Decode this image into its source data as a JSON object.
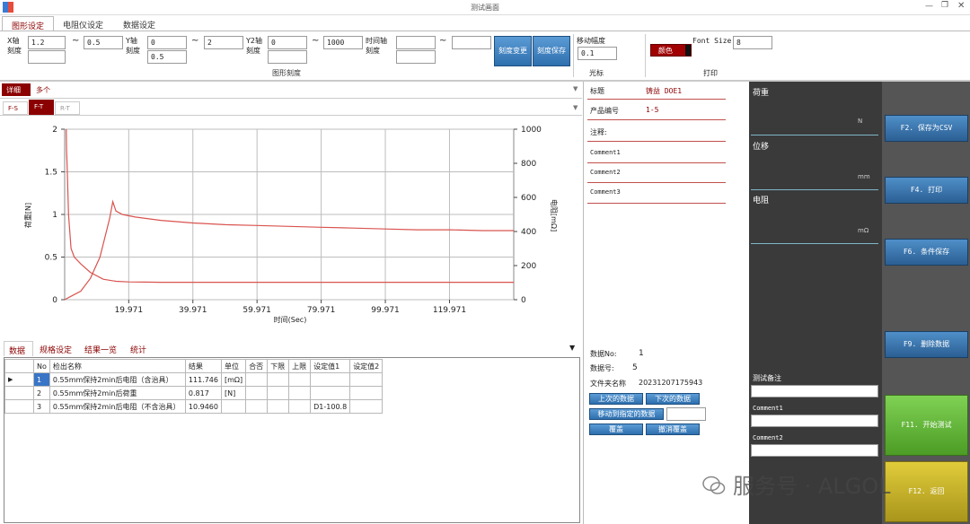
{
  "window": {
    "title": "测试画面"
  },
  "menu_tabs": [
    "图形设定",
    "电阻仪设定",
    "数据设定"
  ],
  "axis_settings": {
    "x_label": "X轴\n刻度",
    "x_min": "1.2",
    "x_max": "0.5",
    "x_extra": "",
    "y_label": "Y轴\n刻度",
    "y_min": "0",
    "y_max": "2",
    "y_extra": "0.5",
    "y2_label": "Y2轴\n刻度",
    "y2_min": "0",
    "y2_max": "1000",
    "y2_extra": "",
    "t_label": "时间轴\n刻度",
    "t_min": "",
    "t_max": "",
    "t_extra": "",
    "tilde": "~",
    "group_label": "图形刻度",
    "btn_change": "刻度变更",
    "btn_save": "刻度保存"
  },
  "cursor": {
    "label": "移动幅度",
    "value": "0.1",
    "group_label": "光标"
  },
  "print_group": {
    "color_label": "颜色",
    "font_label": "Font Size",
    "font_value": "8",
    "group_label": "打印"
  },
  "detail": {
    "btn": "详细",
    "mode": "多个",
    "subtabs": [
      "F-S",
      "F-T",
      "R-T"
    ]
  },
  "chart_data": {
    "type": "line",
    "xlabel": "时间(Sec)",
    "ylabel": "荷重[N]",
    "y2label": "电阻[mΩ]",
    "xlim": [
      0,
      140
    ],
    "ylim": [
      0,
      2
    ],
    "y2lim": [
      0,
      1000
    ],
    "x_ticks": [
      "19.971",
      "39.971",
      "59.971",
      "79.971",
      "99.971",
      "119.971"
    ],
    "x_tick_values": [
      19.971,
      39.971,
      59.971,
      79.971,
      99.971,
      119.971
    ],
    "y_ticks": [
      "0",
      "0.5",
      "1",
      "1.5",
      "2"
    ],
    "y2_ticks": [
      "0",
      "200",
      "400",
      "600",
      "800",
      "1000"
    ],
    "grid": true,
    "series": [
      {
        "axis": "y2",
        "color": "#d9534f",
        "x": [
          0.5,
          0.6,
          0.8,
          1.2,
          2,
          3,
          5,
          8,
          12,
          16,
          20,
          25,
          30,
          40,
          50,
          60,
          70,
          80,
          90,
          100,
          110,
          120,
          130,
          140
        ],
        "y": [
          1000,
          880,
          760,
          500,
          300,
          250,
          210,
          160,
          120,
          108,
          104,
          103,
          102,
          102,
          102,
          102,
          102,
          102,
          102,
          102,
          102,
          102,
          102,
          102
        ]
      },
      {
        "axis": "y",
        "color": "#d9534f",
        "x": [
          0,
          2,
          5,
          8,
          11,
          14,
          15,
          16,
          18,
          22,
          30,
          40,
          50,
          60,
          70,
          80,
          90,
          100,
          110,
          120,
          130,
          140
        ],
        "y": [
          0,
          0.04,
          0.1,
          0.25,
          0.5,
          0.95,
          1.15,
          1.04,
          1.0,
          0.97,
          0.93,
          0.9,
          0.88,
          0.87,
          0.86,
          0.85,
          0.84,
          0.83,
          0.82,
          0.82,
          0.81,
          0.81
        ]
      }
    ]
  },
  "info_panel": {
    "title_label": "标题",
    "title_value": "铸益 DOE1",
    "product_label": "产品编号",
    "product_value": "1-5",
    "note_label": "注释:",
    "comments": [
      "Comment1",
      "Comment2",
      "Comment3"
    ]
  },
  "data_tabs": [
    "数据",
    "规格设定",
    "结果一览",
    "统计"
  ],
  "table": {
    "headers": [
      "No",
      "检出名称",
      "结果",
      "单位",
      "合否",
      "下限",
      "上限",
      "设定值1",
      "设定值2"
    ],
    "rows": [
      [
        "1",
        "0.55mm保持2min后电阻（含治具）",
        "111.746",
        "[mΩ]",
        "",
        "",
        "",
        "",
        ""
      ],
      [
        "2",
        "0.55mm保持2min后荷重",
        "0.817",
        "[N]",
        "",
        "",
        "",
        "",
        ""
      ],
      [
        "3",
        "0.55mm保持2min后电阻（不含治具）",
        "10.9460",
        "",
        "",
        "",
        "",
        "D1-100.8",
        ""
      ]
    ]
  },
  "data_info": {
    "datano_label": "数据No:",
    "datano_value": "1",
    "count_label": "数据号:",
    "count_value": "5",
    "folder_label": "文件夹名称",
    "folder_value": "20231207175943",
    "btn_prev": "上次的数据",
    "btn_next": "下次的数据",
    "btn_goto": "移动到指定的数据",
    "goto_value": "",
    "btn_overwrite": "覆盖",
    "btn_cancel_overwrite": "撤消覆盖"
  },
  "readouts": {
    "load_label": "荷重",
    "load_unit": "N",
    "disp_label": "位移",
    "disp_unit": "mm",
    "res_label": "电阻",
    "res_unit": "mΩ",
    "note_label": "测试备注",
    "comment1_label": "Comment1",
    "comment2_label": "Comment2"
  },
  "side_buttons": {
    "save_csv": "F2. 保存为CSV",
    "print": "F4. 打印",
    "cond_save": "F6. 条件保存",
    "delete": "F9. 删除数据",
    "start": "F11. 开始测试",
    "back": "F12. 返回"
  },
  "watermark": "服务号 · ALGOL",
  "colors": {
    "accent_red": "#8b0000",
    "panel_dark": "#3a3a3a",
    "start_green": "#5cb531",
    "back_yellow": "#c9b62a"
  }
}
